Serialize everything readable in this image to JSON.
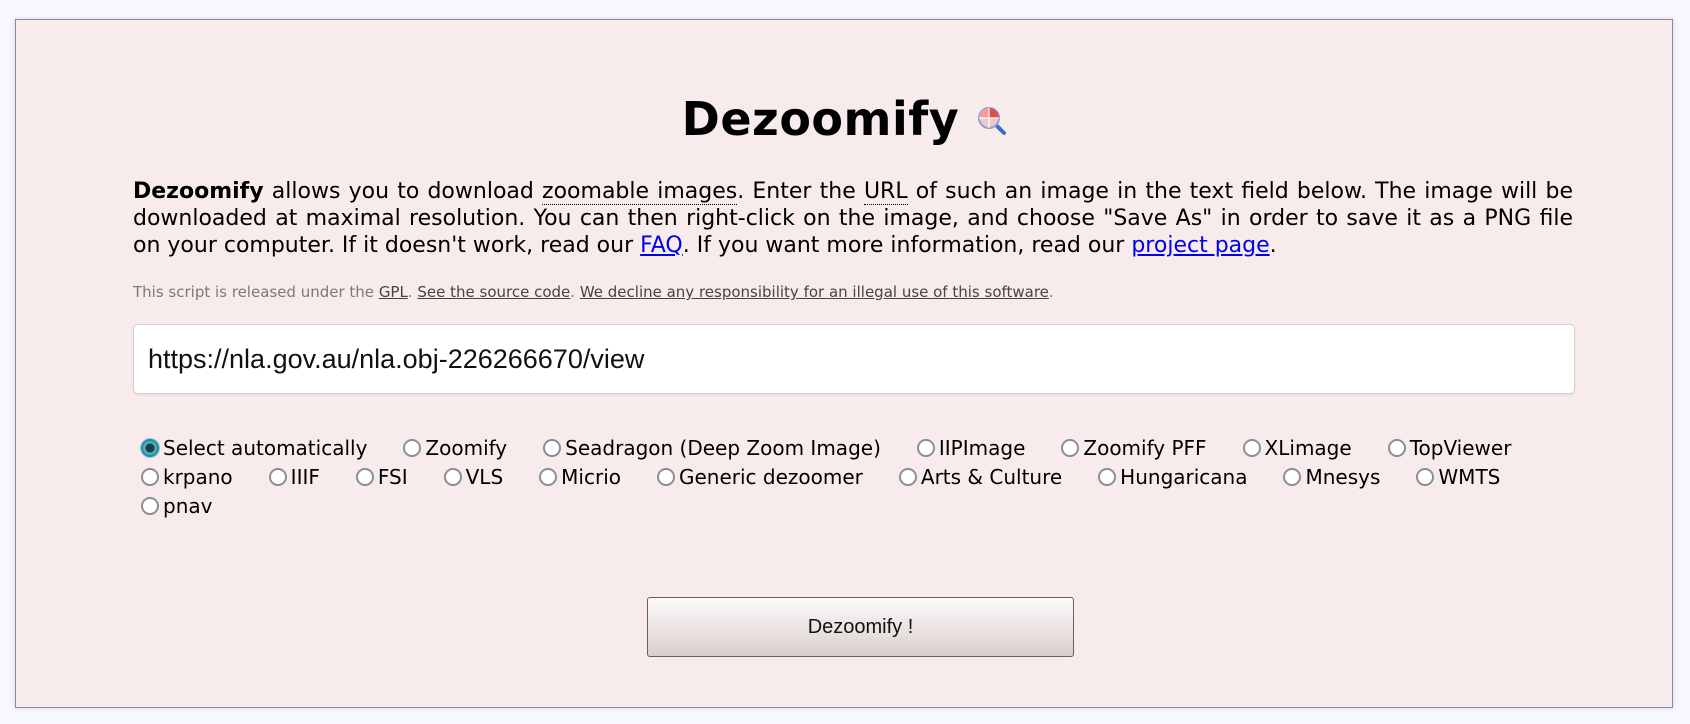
{
  "app": {
    "title": "Dezoomify",
    "logo_icon": "magnifier-icon"
  },
  "description": {
    "brand": "Dezoomify",
    "part1": " allows you to download ",
    "zoomable_images": "zoomable images",
    "part2": ". Enter the ",
    "url_abbr": "URL",
    "part3": " of such an image in the text field below. The image will be downloaded at maximal resolution. You can then right-click on the image, and choose \"Save As\" in order to save it as a PNG file on your computer. If it doesn't work, read our ",
    "faq_link": "FAQ",
    "part4": ". If you want more information, read our ",
    "project_link": "project page",
    "part5": "."
  },
  "license": {
    "part1": "This script is released under the ",
    "gpl_link": "GPL",
    "part2": ". ",
    "source_link": "See the source code",
    "part3": ". ",
    "disclaimer_link": "We decline any responsibility for an illegal use of this software",
    "part4": "."
  },
  "url_input": {
    "value": "https://nla.gov.au/nla.obj-226266670/view"
  },
  "dezoomers": {
    "selected": "Select automatically",
    "options": [
      "Select automatically",
      "Zoomify",
      "Seadragon (Deep Zoom Image)",
      "IIPImage",
      "Zoomify PFF",
      "XLimage",
      "TopViewer",
      "krpano",
      "IIIF",
      "FSI",
      "VLS",
      "Micrio",
      "Generic dezoomer",
      "Arts & Culture",
      "Hungaricana",
      "Mnesys",
      "WMTS",
      "pnav"
    ]
  },
  "submit": {
    "label": "Dezoomify !"
  },
  "colors": {
    "panel_bg": "#f7eceb",
    "link": "#0000ee",
    "radio_checked": "#2b8a9a"
  }
}
